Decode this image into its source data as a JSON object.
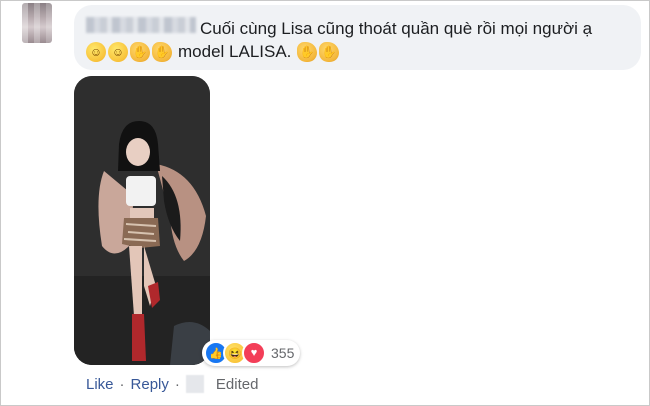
{
  "comment": {
    "text_line1": "Cuối cùng Lisa cũng thoát quần què rồi mọi người ạ",
    "text_line2": "model LALISA.",
    "emojis_before": [
      "grinning-face",
      "grinning-face",
      "clapping-hands",
      "clapping-hands"
    ],
    "emojis_after": [
      "clapping-hands",
      "clapping-hands"
    ]
  },
  "reactions": {
    "types": [
      "like",
      "haha",
      "love"
    ],
    "count": "355"
  },
  "actions": {
    "like": "Like",
    "reply": "Reply",
    "separator": "·",
    "edited": "Edited"
  },
  "colors": {
    "bubble_bg": "#f0f2f5",
    "link": "#385898",
    "meta": "#65676b",
    "like_blue": "#1877f2",
    "love_red": "#f33e58"
  }
}
